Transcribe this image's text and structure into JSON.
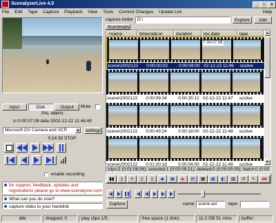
{
  "window": {
    "title": "ScenalyzerLive 4.0"
  },
  "menu": {
    "file": "File",
    "edit": "Edit",
    "tape": "Tape",
    "capture": "Capture",
    "playback": "Playback",
    "view": "View",
    "tools": "Tools",
    "commit": "Commit Changes",
    "update": "Update List",
    "help": "Help"
  },
  "preview": {
    "input_label": "Input",
    "disk_label": "Disk",
    "output_label": "Output",
    "mute_label": "Mute",
    "format": "PAL 48kHz",
    "timecode": "tc:0:00:07:08  date:2002-12-22 11:46:49",
    "device": "Microsoft DV Camera and VCR",
    "settings_label": "settings",
    "transport_status": "0:24:39 STOP",
    "enable_recording": "enable recording"
  },
  "messages": [
    {
      "text": "for support, feedback, updates and registrations please go to www.scenalyzer.com",
      "color": "#c00000"
    },
    {
      "text": "What can you do now?",
      "color": "#000000"
    },
    {
      "text": "capture video to your harddisk",
      "color": "#000000"
    }
  ],
  "status": {
    "state": "idle",
    "dropped": "dropped: 0",
    "play_clips": "play clips:1/5;",
    "free_space": "free space (1 disk):",
    "size": "11.0 GB 51 mins",
    "buffer": "buffer:"
  },
  "capture": {
    "folder_label": "capture-folder",
    "folder_value": "D:\\",
    "explore_label": "Explore",
    "add_label": "Add"
  },
  "grid": {
    "tab": "thumbnails",
    "columns": [
      "name",
      "timecode-in",
      "duration",
      "rec.date",
      "tape"
    ],
    "rows": [
      {
        "name": "scene\\20021222",
        "tc": "0:00:00:03",
        "duration": "0:00:08:00",
        "date": "02-12-22 11:46",
        "tape": "scclive",
        "overlay": "T 00:07:08"
      },
      {
        "name": "scene\\20021222",
        "tc": "0:00:09:24",
        "duration": "0:00:35:12",
        "date": "02-12-22 11:47",
        "tape": "scclive"
      },
      {
        "name": "scene\\20021222",
        "tc": "0:00:43:24",
        "duration": "0:00:18:00",
        "date": "02-12-22 11:48",
        "tape": "scclive"
      },
      {
        "name": "scene\\20021222",
        "tc": "0:01:00:18",
        "duration": "0:00:04:00",
        "date": "02-12-22 11:48",
        "tape": "scclive"
      }
    ],
    "summary": "clips:5 (0:01:06:06); selected:1 (0:00:09:21); deleted:0 (0:00:00:00); batch:0 (0:00:00:00);"
  },
  "bottom": {
    "capture_label": "Capture",
    "name_label": "name:",
    "name_value": "scene.avi",
    "tape_label": "tape:",
    "tape_value": ""
  },
  "colors": {
    "selection": "#0a246a",
    "title_start": "#0a246a",
    "title_end": "#3a6ea5",
    "accent_blue": "#1a3fd0"
  }
}
